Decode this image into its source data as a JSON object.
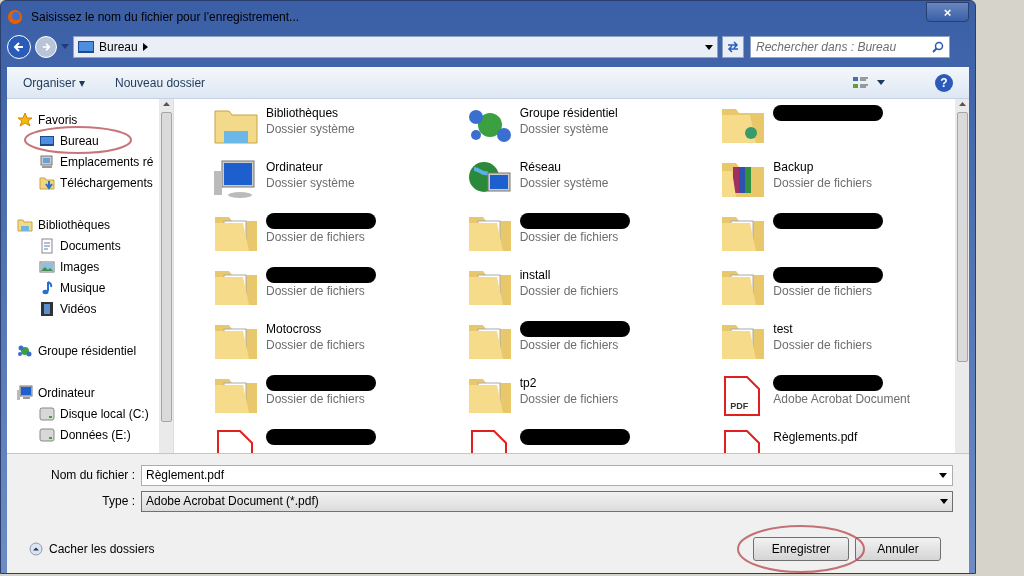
{
  "window": {
    "title": "Saisissez le nom du fichier pour l’enregistrement...",
    "close": "×"
  },
  "address": {
    "location": "Bureau",
    "search_placeholder": "Rechercher dans : Bureau"
  },
  "toolbar": {
    "organize": "Organiser ▾",
    "new_folder": "Nouveau dossier",
    "help": "?"
  },
  "sidebar": {
    "groups": [
      {
        "label": "Favoris",
        "kind": "star",
        "children": [
          {
            "label": "Bureau",
            "kind": "desktop",
            "circled": true
          },
          {
            "label": "Emplacements ré",
            "kind": "places"
          },
          {
            "label": "Téléchargements",
            "kind": "download"
          }
        ]
      },
      {
        "label": "Bibliothèques",
        "kind": "library",
        "children": [
          {
            "label": "Documents",
            "kind": "document"
          },
          {
            "label": "Images",
            "kind": "image"
          },
          {
            "label": "Musique",
            "kind": "music"
          },
          {
            "label": "Vidéos",
            "kind": "video"
          }
        ]
      },
      {
        "label": "Groupe résidentiel",
        "kind": "homegroup"
      },
      {
        "label": "Ordinateur",
        "kind": "computer",
        "children": [
          {
            "label": "Disque local (C:)",
            "kind": "drive"
          },
          {
            "label": "Données (E:)",
            "kind": "drive"
          }
        ]
      }
    ]
  },
  "items": [
    {
      "name": "Bibliothèques",
      "type": "Dossier système",
      "kind": "library"
    },
    {
      "name": "Groupe résidentiel",
      "type": "Dossier système",
      "kind": "homegroup"
    },
    {
      "kind": "user-folder",
      "redacted": true
    },
    {
      "name": "Ordinateur",
      "type": "Dossier système",
      "kind": "computer"
    },
    {
      "name": "Réseau",
      "type": "Dossier système",
      "kind": "network"
    },
    {
      "name": "Backup",
      "type": "Dossier de fichiers",
      "kind": "archive-folder"
    },
    {
      "type": "Dossier de fichiers",
      "kind": "folder",
      "redacted": true
    },
    {
      "type": "Dossier de fichiers",
      "kind": "folder",
      "redacted": true
    },
    {
      "kind": "folder",
      "redacted": true
    },
    {
      "type": "Dossier de fichiers",
      "kind": "folder",
      "redacted": true
    },
    {
      "name": "install",
      "type": "Dossier de fichiers",
      "kind": "folder"
    },
    {
      "type": "Dossier de fichiers",
      "kind": "folder",
      "redacted": true
    },
    {
      "name": "Motocross",
      "type": "Dossier de fichiers",
      "kind": "folder"
    },
    {
      "type": "Dossier de fichiers",
      "kind": "folder",
      "redacted": true
    },
    {
      "name": "test",
      "type": "Dossier de fichiers",
      "kind": "folder"
    },
    {
      "type": "Dossier de fichiers",
      "kind": "folder",
      "redacted": true
    },
    {
      "name": "tp2",
      "type": "Dossier de fichiers",
      "kind": "folder"
    },
    {
      "type": "Adobe Acrobat Document",
      "kind": "pdf",
      "icon_text": "PDF",
      "redacted": true
    },
    {
      "kind": "pdf",
      "redacted": true
    },
    {
      "kind": "pdf",
      "redacted": true
    },
    {
      "name": "Règlements.pdf",
      "kind": "pdf"
    }
  ],
  "form": {
    "filename_label": "Nom du fichier :",
    "filename": "Règlement.pdf",
    "type_label": "Type :",
    "type": "Adobe Acrobat Document (*.pdf)"
  },
  "footer": {
    "hide_folders": "Cacher les dossiers",
    "save": "Enregistrer",
    "save_circled": true,
    "cancel": "Annuler"
  }
}
